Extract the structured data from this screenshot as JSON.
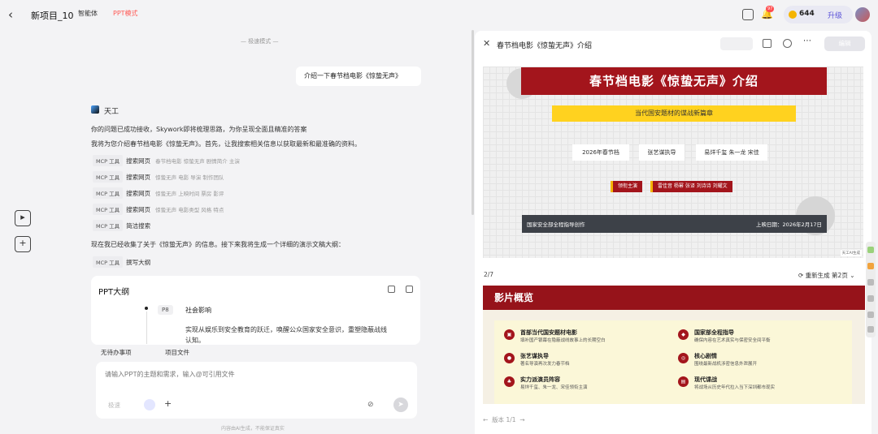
{
  "header": {
    "project_title": "新项目_10",
    "agent_label": "智能体",
    "mode_label": "PPT模式",
    "notification_count": "97",
    "credits": "644",
    "upgrade_label": "升级"
  },
  "chat": {
    "speed_mode": "— 极速模式 —",
    "user_message": "介绍一下春节档电影《惊蛰无声》",
    "assistant_name": "天工",
    "intro_lines": [
      "你的问题已成功接收，Skywork即将梳理思路，为你呈现全面且精准的答案",
      "我将为您介绍春节档电影《惊蛰无声》。首先，让我搜索相关信息以获取最新和最准确的资料。"
    ],
    "tool_calls": [
      {
        "tag": "MCP 工具",
        "name": "搜索网页",
        "query": "春节档电影 惊蛰无声 剧情简介 主演"
      },
      {
        "tag": "MCP 工具",
        "name": "搜索网页",
        "query": "惊蛰无声 电影 导演 制作团队"
      },
      {
        "tag": "MCP 工具",
        "name": "搜索网页",
        "query": "惊蛰无声 上映时间 票房 影评"
      },
      {
        "tag": "MCP 工具",
        "name": "搜索网页",
        "query": "惊蛰无声 电影类型 风格 特点"
      },
      {
        "tag": "MCP 工具",
        "name": "简洁搜索",
        "query": ""
      }
    ],
    "outline_intro": "现在我已经收集了关于《惊蛰无声》的信息。接下来我将生成一个详细的演示文稿大纲：",
    "outline_tool": {
      "tag": "MCP 工具",
      "name": "撰写大纲"
    },
    "outline_card": {
      "title": "PPT大纲",
      "page_tag": "P8",
      "heading": "社会影响",
      "text": "实现从娱乐到安全教育的跃迁，唤醒公众国家安全意识，重塑隐蔽战线认知。"
    },
    "todo_label": "无待办事项",
    "project_files_label": "项目文件",
    "input_placeholder": "请输入PPT的主题和需求，输入@可引用文件",
    "think_label": "极速",
    "disclaimer": "内容由AI生成，不能保证真实"
  },
  "panel": {
    "title": "春节档电影《惊蛰无声》介绍",
    "edit_label": "编辑",
    "pager": "2/7",
    "regen_label": "重新生成 第2页",
    "version_label": "版本 1/1"
  },
  "slide1": {
    "title": "春节档电影《惊蛰无声》介绍",
    "subtitle": "当代国安题材的谍战新篇章",
    "cards": [
      "2026年春节档",
      "张艺谋执导",
      "易烊千玺 朱一龙 宋佳"
    ],
    "chips": [
      "领衔主演",
      "雷佳音 杨幂 张译 刘诗诗 刘耀文"
    ],
    "footer_left": "国家安全部全程指导创作",
    "footer_right": "上映日期：2026年2月17日",
    "watermark": "天工AI生成"
  },
  "slide2": {
    "title": "影片概览",
    "items": [
      {
        "title": "首部当代国安题材电影",
        "desc": "填补国产银幕在隐蔽战线故事上的长期空白"
      },
      {
        "title": "国家部全程指导",
        "desc": "确保内容在艺术真实与保密安全间平衡"
      },
      {
        "title": "张艺谋执导",
        "desc": "著名导演再次发力春节档"
      },
      {
        "title": "核心剧情",
        "desc": "围绕最新战机涉密信息外泄展开"
      },
      {
        "title": "实力派演员阵容",
        "desc": "易烊千玺、朱一龙、宋佳领衔主演"
      },
      {
        "title": "现代谍战",
        "desc": "将战场从历史年代拉入当下深圳都市现实"
      }
    ]
  }
}
